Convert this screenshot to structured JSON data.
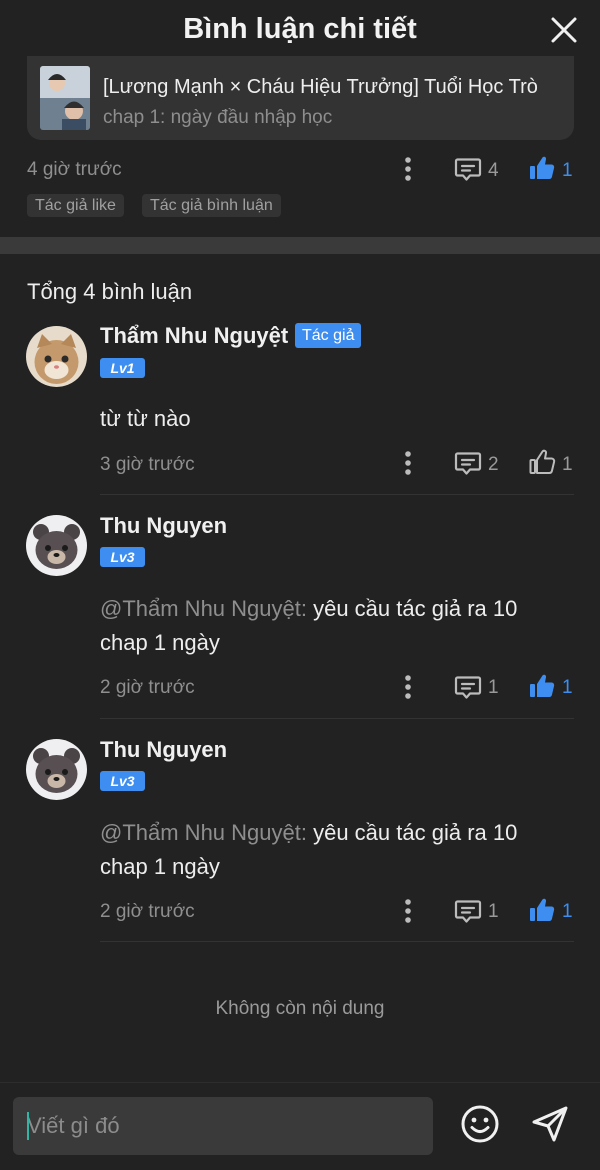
{
  "header": {
    "title": "Bình luận chi tiết",
    "close_icon": "close-icon"
  },
  "manga": {
    "title": "[Lương Mạnh × Cháu Hiệu Trưởng] Tuổi Học Trò",
    "chapter": "chap 1: ngày đầu nhập học"
  },
  "post": {
    "time": "4 giờ trước",
    "comments": "4",
    "likes": "1",
    "liked": true,
    "tags": [
      "Tác giả like",
      "Tác giả bình luận"
    ]
  },
  "total_label": "Tổng 4 bình luận",
  "comments": [
    {
      "name": "Thẩm Nhu Nguyệt",
      "badge": "Tác giả",
      "level": "Lv1",
      "mention": "",
      "text": "từ từ nào",
      "time": "3 giờ trước",
      "replies": "2",
      "likes": "1",
      "liked": false
    },
    {
      "name": "Thu Nguyen",
      "level": "Lv3",
      "mention": "@Thẩm Nhu Nguyệt:",
      "text": " yêu cầu tác giả ra 10 chap 1 ngày",
      "time": "2 giờ trước",
      "replies": "1",
      "likes": "1",
      "liked": true
    },
    {
      "name": "Thu Nguyen",
      "level": "Lv3",
      "mention": "@Thẩm Nhu Nguyệt:",
      "text": " yêu cầu tác giả ra 10 chap 1 ngày",
      "time": "2 giờ trước",
      "replies": "1",
      "likes": "1",
      "liked": true
    }
  ],
  "end_label": "Không còn nội dung",
  "composer": {
    "placeholder": "Viết gì đó",
    "emoji_icon": "smile-icon",
    "send_icon": "send-icon"
  },
  "colors": {
    "accent": "#3d8ef0",
    "background": "#222222",
    "card": "#333333"
  }
}
